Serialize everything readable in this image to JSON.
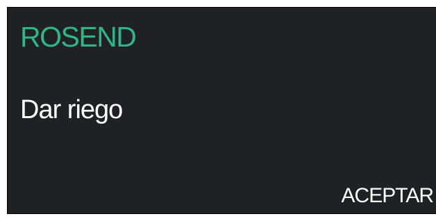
{
  "dialog": {
    "title": "ROSEND",
    "message": "Dar riego",
    "accept_label": "ACEPTAR"
  },
  "colors": {
    "background": "#202124",
    "title": "#2fb586",
    "text": "#ffffff"
  }
}
